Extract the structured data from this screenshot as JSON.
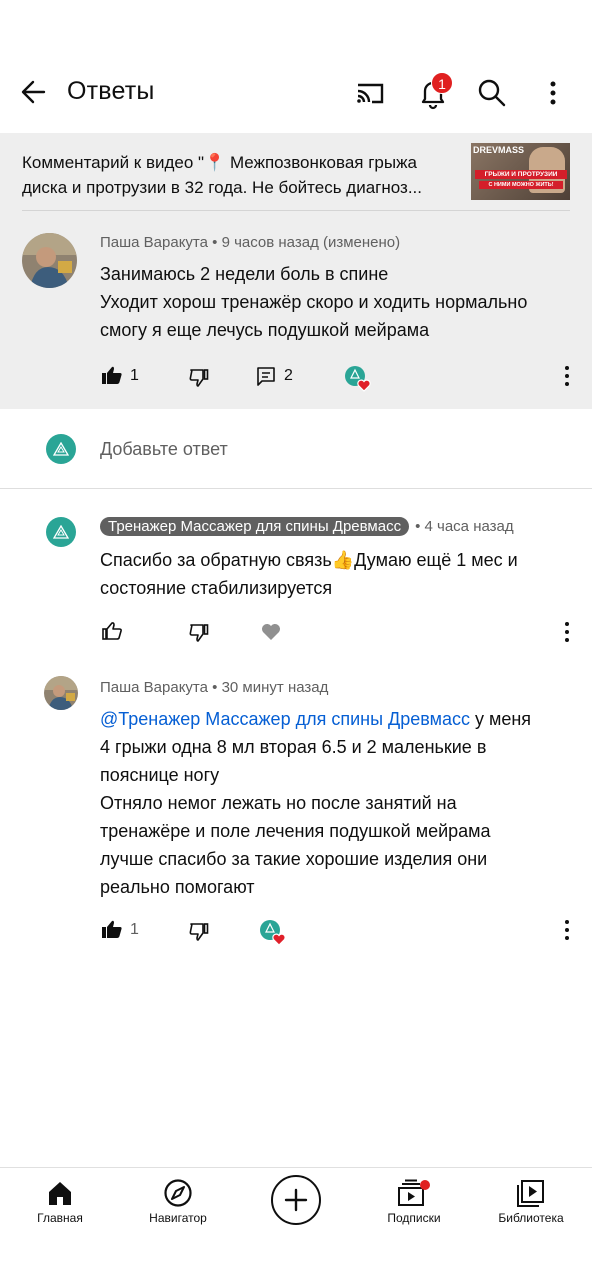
{
  "header": {
    "title": "Ответы",
    "notification_count": "1"
  },
  "context": {
    "line1": "Комментарий к видео \"📍 Межпозвонковая грыжа",
    "line2": "диска и протрузии в 32 года. Не бойтесь диагноз...",
    "thumbnail": {
      "brand": "DREVMASS",
      "line1": "ГРЫЖИ И ПРОТРУЗИИ",
      "line2": "С НИМИ МОЖНО ЖИТЬ!"
    }
  },
  "root_comment": {
    "author": "Паша Варакута",
    "time": "• 9 часов назад (изменено)",
    "lines": [
      "Занимаюсь 2 недели боль в спине",
      "Уходит хорош тренажёр скоро и ходить нормально",
      "смогу я еще лечусь подушкой мейрама"
    ],
    "likes": "1",
    "replies": "2"
  },
  "add_reply_placeholder": "Добавьте ответ",
  "replies": [
    {
      "author": "Тренажер Массажер для спины Древмасс",
      "time": "• 4 часа назад",
      "lines": [
        "Спасибо за обратную связь👍Думаю ещё 1 мес и",
        "состояние стабилизируется"
      ]
    },
    {
      "author": "Паша Варакута",
      "time": "• 30 минут назад",
      "mention": "@Тренажер Массажер для спины Древмасс",
      "first_line_rest": " у меня",
      "lines": [
        "4 грыжи одна 8 мл вторая 6.5 и 2 маленькие в",
        "пояснице ногу",
        "Отняло немог лежать но после занятий на",
        "тренажёре и поле лечения подушкой мейрама",
        "лучше спасибо за такие хорошие изделия они",
        "реально помогают"
      ],
      "likes": "1"
    }
  ],
  "bottom_nav": {
    "home": "Главная",
    "explore": "Навигатор",
    "subscriptions": "Подписки",
    "library": "Библиотека"
  },
  "colors": {
    "channel": "#2aa596",
    "badge": "#e02020",
    "mention": "#065fd4",
    "panel": "#eeeeee"
  }
}
